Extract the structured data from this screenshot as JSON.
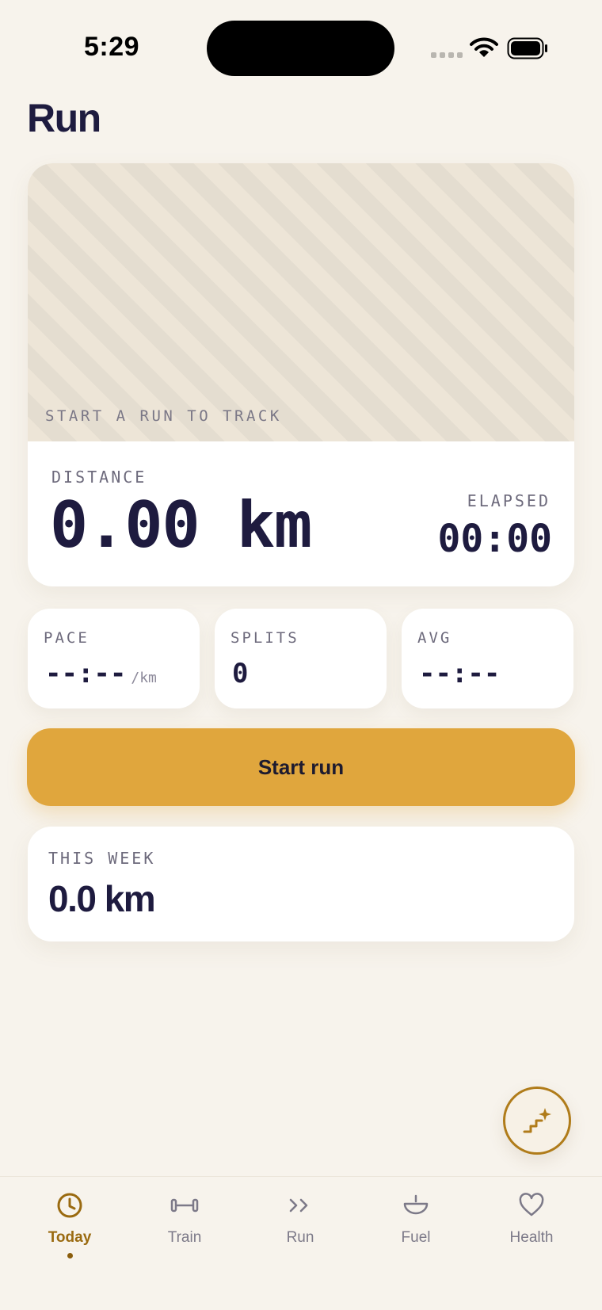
{
  "status_bar": {
    "time": "5:29"
  },
  "page": {
    "title": "Run"
  },
  "map": {
    "caption": "START A RUN TO TRACK"
  },
  "distance": {
    "label": "DISTANCE",
    "value": "0.00 km"
  },
  "elapsed": {
    "label": "ELAPSED",
    "value": "00:00"
  },
  "stats": {
    "pace": {
      "label": "PACE",
      "value": "--:--",
      "unit": "/km"
    },
    "splits": {
      "label": "SPLITS",
      "value": "0"
    },
    "avg": {
      "label": "AVG",
      "value": "--:--"
    }
  },
  "start_button": {
    "label": "Start run"
  },
  "this_week": {
    "label": "THIS WEEK",
    "value": "0.0 km"
  },
  "fab": {
    "icon": "stairs-sparkle-icon"
  },
  "tabs": [
    {
      "label": "Today",
      "icon": "clock-icon",
      "active": true
    },
    {
      "label": "Train",
      "icon": "dumbbell-icon",
      "active": false
    },
    {
      "label": "Run",
      "icon": "double-chevron-icon",
      "active": false
    },
    {
      "label": "Fuel",
      "icon": "bowl-icon",
      "active": false
    },
    {
      "label": "Health",
      "icon": "heart-icon",
      "active": false
    }
  ],
  "colors": {
    "background": "#f7f3ec",
    "accent": "#e0a63d",
    "accent_dark": "#9a6a10",
    "text": "#1e1b3f",
    "muted": "#6d6a7c"
  }
}
